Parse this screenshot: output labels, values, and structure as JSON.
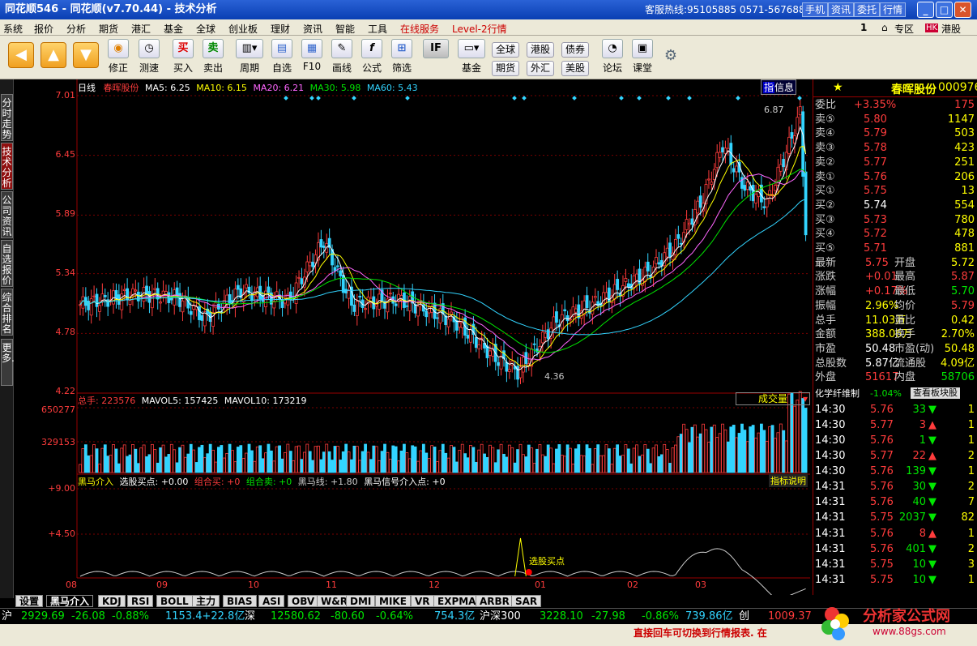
{
  "window": {
    "title": "同花顺546 - 同花顺(v7.70.44) - 技术分析",
    "hotline": "客服热线:95105885 0571-56768888",
    "top_buttons": [
      "手机",
      "资讯",
      "委托",
      "行情"
    ]
  },
  "menu": {
    "items": [
      "系统",
      "报价",
      "分析",
      "期货",
      "港汇",
      "基金",
      "全球",
      "创业板",
      "理财",
      "资讯",
      "智能",
      "工具"
    ],
    "service": "在线服务",
    "level2": "Level-2行情",
    "page_num": "1",
    "zone": "专区",
    "hk": "港股"
  },
  "toolbar": {
    "buttons": [
      "修正",
      "测速",
      "买入",
      "卖出",
      "周期",
      "自选",
      "F10",
      "画线",
      "公式",
      "筛选",
      "基金",
      "论坛",
      "课堂"
    ],
    "small": [
      "全球",
      "港股",
      "债券",
      "期货",
      "外汇",
      "美股"
    ]
  },
  "sidetabs": [
    "分时走势",
    "技术分析",
    "公司资讯",
    "自选报价",
    "综合排名",
    "更多..."
  ],
  "chart": {
    "period": "日线",
    "stock": "春晖股份",
    "ma": [
      {
        "label": "MA5: 6.25",
        "color": "#ffffff"
      },
      {
        "label": "MA10: 6.15",
        "color": "#ffff00"
      },
      {
        "label": "MA20: 6.21",
        "color": "#ff66ff"
      },
      {
        "label": "MA30: 5.98",
        "color": "#00e600"
      },
      {
        "label": "MA60: 5.43",
        "color": "#32d4ff"
      }
    ],
    "yticks": [
      "7.01",
      "6.45",
      "5.89",
      "5.34",
      "4.78",
      "4.22"
    ],
    "high_label": "6.87",
    "low_label": "4.36",
    "info_btn": "信息",
    "vol": {
      "total": "总手: 223576",
      "mavol5": "MAVOL5: 157425",
      "mavol10": "MAVOL10: 173219",
      "yticks": [
        "650277",
        "329153"
      ],
      "select": "成交量"
    },
    "ind": {
      "name": "黑马介入",
      "text": "选股买点: +0.00",
      "zhmai": "组合买: +0",
      "zhmaic": "组合卖: +0",
      "hmx": "黑马线: +1.80",
      "hmxh": "黑马信号介入点: +0",
      "yticks": [
        "+9.00",
        "+4.50"
      ],
      "note": "选股买点",
      "explain": "指标说明"
    },
    "months": [
      "08",
      "09",
      "10",
      "11",
      "12",
      "01",
      "02",
      "03"
    ]
  },
  "chart_data": {
    "type": "candlestick",
    "ylim": [
      4.22,
      7.01
    ],
    "high": 6.87,
    "low": 4.36
  },
  "quote": {
    "name": "春晖股份",
    "code": "000976",
    "webi_label": "委比",
    "webi": "+3.35%",
    "webi_val": "175",
    "sells": [
      {
        "l": "卖⑤",
        "p": "5.80",
        "v": "1147"
      },
      {
        "l": "卖④",
        "p": "5.79",
        "v": "503"
      },
      {
        "l": "卖③",
        "p": "5.78",
        "v": "423"
      },
      {
        "l": "卖②",
        "p": "5.77",
        "v": "251"
      },
      {
        "l": "卖①",
        "p": "5.76",
        "v": "206"
      }
    ],
    "buys": [
      {
        "l": "买①",
        "p": "5.75",
        "v": "13"
      },
      {
        "l": "买②",
        "p": "5.74",
        "v": "554"
      },
      {
        "l": "买③",
        "p": "5.73",
        "v": "780"
      },
      {
        "l": "买④",
        "p": "5.72",
        "v": "478"
      },
      {
        "l": "买⑤",
        "p": "5.71",
        "v": "881"
      }
    ],
    "stats": [
      [
        "最新",
        "5.75",
        "开盘",
        "5.72"
      ],
      [
        "涨跌",
        "+0.01",
        "最高",
        "5.87"
      ],
      [
        "涨幅",
        "+0.17%",
        "最低",
        "5.70"
      ],
      [
        "振幅",
        "2.96%",
        "均价",
        "5.79"
      ],
      [
        "总手",
        "11.03万",
        "量比",
        "0.42"
      ],
      [
        "金额",
        "388.06万",
        "换手",
        "2.70%"
      ],
      [
        "市盈",
        "50.48",
        "市盈(动)",
        "50.48"
      ],
      [
        "总股数",
        "5.87亿",
        "流通股",
        "4.09亿"
      ],
      [
        "外盘",
        "51617",
        "内盘",
        "58706"
      ]
    ],
    "sector": "化学纤维制",
    "sector_pct": "-1.04%",
    "sector_btn": "查看板块股",
    "ticks": [
      [
        "14:30",
        "5.76",
        "33",
        "d",
        "1"
      ],
      [
        "14:30",
        "5.77",
        "3",
        "u",
        "1"
      ],
      [
        "14:30",
        "5.76",
        "1",
        "d",
        "1"
      ],
      [
        "14:30",
        "5.77",
        "22",
        "u",
        "2"
      ],
      [
        "14:30",
        "5.76",
        "139",
        "d",
        "1"
      ],
      [
        "14:31",
        "5.76",
        "30",
        "d",
        "2"
      ],
      [
        "14:31",
        "5.76",
        "40",
        "d",
        "7"
      ],
      [
        "14:31",
        "5.75",
        "2037",
        "d",
        "82"
      ],
      [
        "14:31",
        "5.76",
        "8",
        "u",
        "1"
      ],
      [
        "14:31",
        "5.76",
        "401",
        "d",
        "2"
      ],
      [
        "14:31",
        "5.75",
        "10",
        "d",
        "3"
      ],
      [
        "14:31",
        "5.75",
        "10",
        "d",
        "1"
      ]
    ]
  },
  "bottomtabs": [
    "设置",
    "黑马介入",
    "KDJ",
    "RSI",
    "BOLL",
    "主力",
    "BIAS",
    "ASI",
    "OBV",
    "W&R",
    "DMI",
    "MIKE",
    "VR",
    "EXPMA",
    "ARBR",
    "SAR"
  ],
  "ticker": {
    "sh": "沪",
    "sh_idx": "2929.69",
    "sh_chg": "-26.08",
    "sh_pct": "-0.88%",
    "sh_amt": "1153.4+22.8亿",
    "sz": "深",
    "sz_idx": "12580.62",
    "sz_chg": "-80.60",
    "sz_pct": "-0.64%",
    "sz_amt": "754.3亿",
    "hs": "沪深300",
    "hs_idx": "3228.10",
    "hs_chg": "-27.98",
    "hs_pct": "-0.86%",
    "hs_amt": "739.86亿",
    "cy": "创",
    "cy_idx": "1009.37"
  },
  "status": {
    "msg": "直接回车可切换到行情报表. 在"
  },
  "logo": {
    "text": "分析家公式网",
    "url": "www.88gs.com"
  }
}
